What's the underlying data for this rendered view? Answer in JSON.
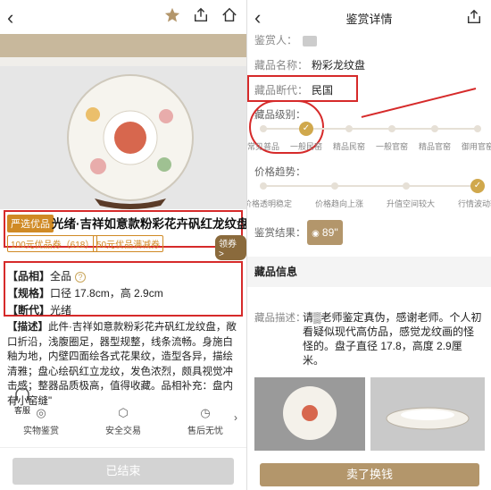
{
  "left": {
    "badge": "严选优品",
    "title": "光绪·吉祥如意款粉彩花卉矾红龙纹盘",
    "coupons": [
      "100元优品券（618）",
      "50元优品满减券"
    ],
    "claim": "领券 >",
    "rows": {
      "pinxiang_label": "【品相】",
      "pinxiang_value": "全品",
      "guige_label": "【规格】",
      "guige_value": "口径 17.8cm，高 2.9cm",
      "duandai_label": "【断代】",
      "duandai_value": "光绪"
    },
    "desc_label": "【描述】",
    "desc_text": "此件·吉祥如意款粉彩花卉矾红龙纹盘，敞口折沿，浅腹圈足，器型规整，线条流畅。身施白釉为地，内壁四面绘各式花果纹，造型各异，描绘清雅；盘心绘矾红立龙纹，发色浓烈，颇具视觉冲击感；整器品质极高，值得收藏。品相补充：盘内有小窑缝\"",
    "service_label": "客服",
    "features": [
      "实物鉴赏",
      "安全交易",
      "售后无忧"
    ],
    "end_button": "已结束"
  },
  "right": {
    "title": "鉴赏详情",
    "appraiser_label": "鉴赏人：",
    "name_label": "藏品名称：",
    "name_value": "粉彩龙纹盘",
    "era_label": "藏品断代：",
    "era_value": "民国",
    "grade_label": "藏品级别：",
    "grade_levels": [
      "常见普品",
      "一般民窑",
      "精品民窑",
      "一般官窑",
      "精品官窑",
      "御用官窑"
    ],
    "grade_selected": 1,
    "trend_label": "价格趋势：",
    "trend_levels": [
      "价格透明稳定",
      "价格趋向上涨",
      "升值空间较大",
      "行情波动较大"
    ],
    "trend_selected": 3,
    "result_label": "鉴赏结果：",
    "result_value": "89''",
    "section_title": "藏品信息",
    "desc_label": "藏品描述：",
    "desc_text": "请▒老师鉴定真伪，感谢老师。个人初看疑似现代高仿品，感觉龙纹画的怪怪的。盘子直径 17.8，高度 2.9厘米。",
    "sell_button": "卖了换钱"
  },
  "colors": {
    "accent": "#d08a25",
    "highlight": "#d62a2a",
    "gold": "#b3966b"
  }
}
